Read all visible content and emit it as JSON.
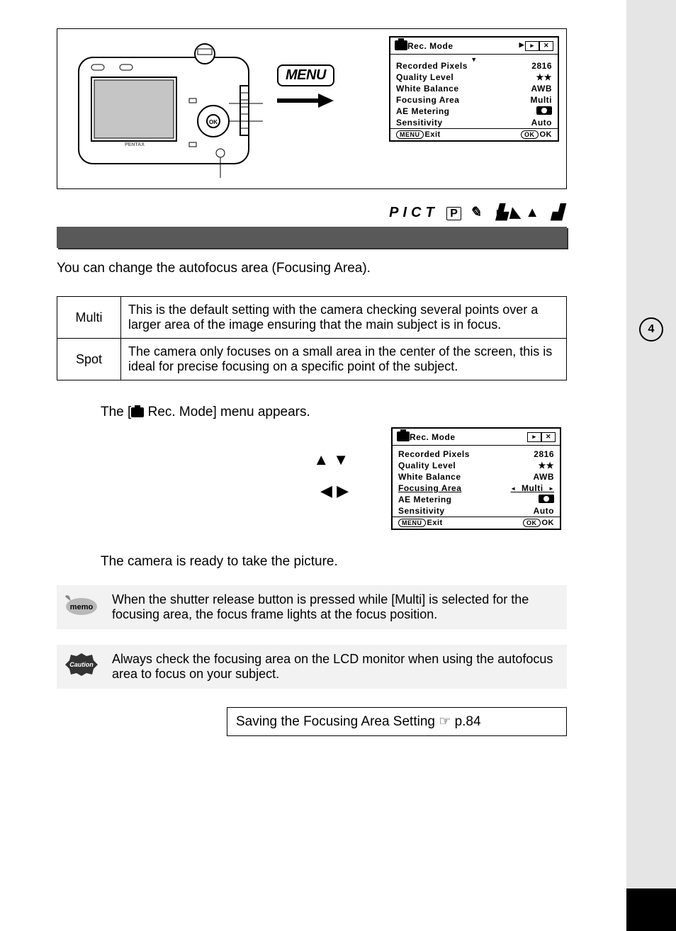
{
  "page_number": "4",
  "menu_label": "MENU",
  "mode_strip": {
    "pict": "PICT",
    "p_box": "P"
  },
  "intro": "You can change the autofocus area (Focusing Area).",
  "table": {
    "rows": [
      {
        "name": "Multi",
        "desc": "This is the default setting with the camera checking several points over a larger area of the image ensuring that the main subject is in focus."
      },
      {
        "name": "Spot",
        "desc": "The camera only focuses on a small area in the center of the screen, this is ideal for precise focusing on a specific point of the subject."
      }
    ]
  },
  "step1_text_pre": "The [",
  "step1_text_post": " Rec. Mode] menu appears.",
  "step3_text": "The camera is ready to take the picture.",
  "step2_arrows_row1": "▲ ▼",
  "step2_arrows_row2": "◀ ▶",
  "lcd": {
    "title": "Rec. Mode",
    "rows": [
      {
        "label": "Recorded Pixels",
        "value": "2816"
      },
      {
        "label": "Quality Level",
        "value": "★★"
      },
      {
        "label": "White Balance",
        "value": "AWB"
      },
      {
        "label": "Focusing Area",
        "value": "Multi"
      },
      {
        "label": "AE Metering",
        "value": ""
      },
      {
        "label": "Sensitivity",
        "value": "Auto"
      }
    ],
    "exit": "Exit",
    "ok": "OK",
    "menu_pill": "MENU",
    "ok_pill": "OK"
  },
  "memo_label": "memo",
  "memo_text": "When the shutter release button is pressed while [Multi] is selected for the focusing area, the focus frame lights at the focus position.",
  "caution_label": "Caution",
  "caution_text": "Always check the focusing area on the LCD monitor when using the autofocus area to focus on your subject.",
  "footer_link": "Saving the Focusing Area Setting ",
  "footer_page": "p.84"
}
